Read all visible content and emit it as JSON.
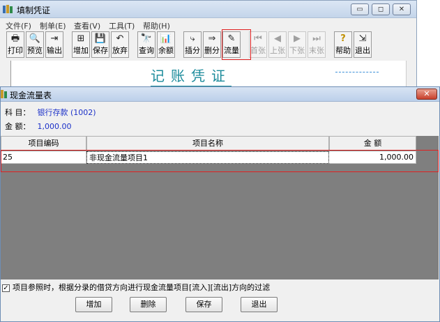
{
  "bg_window": {
    "title": "填制凭证",
    "controls": {
      "minimize": "▭",
      "maximize": "◻",
      "close": "✕"
    },
    "menu": [
      "文件(F)",
      "制单(E)",
      "查看(V)",
      "工具(T)",
      "帮助(H)"
    ],
    "toolbar": [
      {
        "label": "打印",
        "icon": "🖶"
      },
      {
        "label": "预览",
        "icon": "🔍"
      },
      {
        "label": "输出",
        "icon": "⇥"
      },
      {
        "label": "增加",
        "icon": "⊞"
      },
      {
        "label": "保存",
        "icon": "💾"
      },
      {
        "label": "放弃",
        "icon": "↶"
      },
      {
        "label": "查询",
        "icon": "🔭"
      },
      {
        "label": "余额",
        "icon": "📊"
      },
      {
        "label": "插分",
        "icon": "⤷"
      },
      {
        "label": "删分",
        "icon": "⇒"
      },
      {
        "label": "流量",
        "icon": "✎"
      },
      {
        "label": "首张",
        "icon": "⏮"
      },
      {
        "label": "上张",
        "icon": "◀"
      },
      {
        "label": "下张",
        "icon": "▶"
      },
      {
        "label": "末张",
        "icon": "⏭"
      },
      {
        "label": "帮助",
        "icon": "?"
      },
      {
        "label": "退出",
        "icon": "⇲"
      }
    ],
    "voucher_title": "记账凭证"
  },
  "dialog": {
    "title": "现金流量表",
    "close": "✕",
    "subject_label": "科  目：",
    "subject_value": "银行存款 (1002)",
    "amount_label": "金  额：",
    "amount_value": "1,000.00",
    "columns": [
      "项目编码",
      "项目名称",
      "金  额"
    ],
    "rows": [
      {
        "code": "25",
        "name": "非现金流量项目1",
        "amount": "1,000.00"
      }
    ],
    "filter_label": "项目参照时，根据分录的借贷方向进行现金流量项目[流入][流出]方向的过滤",
    "filter_mark": "✓",
    "buttons": {
      "add": "增加",
      "delete": "删除",
      "save": "保存",
      "exit": "退出"
    }
  }
}
